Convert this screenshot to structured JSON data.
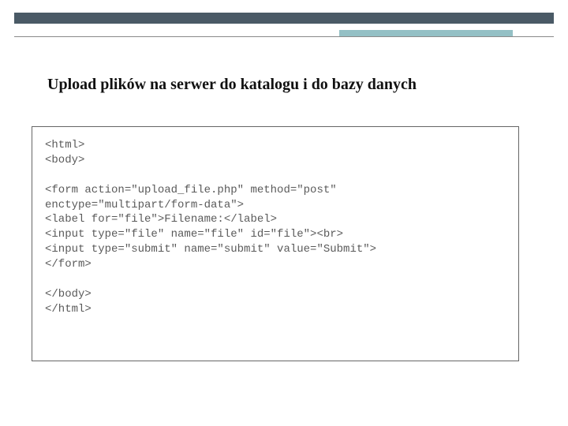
{
  "header": {
    "title": "Upload plików na serwer do katalogu i do bazy danych"
  },
  "code": {
    "lines": [
      "<html>",
      "<body>",
      "",
      "<form action=\"upload_file.php\" method=\"post\"",
      "enctype=\"multipart/form-data\">",
      "<label for=\"file\">Filename:</label>",
      "<input type=\"file\" name=\"file\" id=\"file\"><br>",
      "<input type=\"submit\" name=\"submit\" value=\"Submit\">",
      "</form>",
      "",
      "</body>",
      "</html>"
    ]
  }
}
